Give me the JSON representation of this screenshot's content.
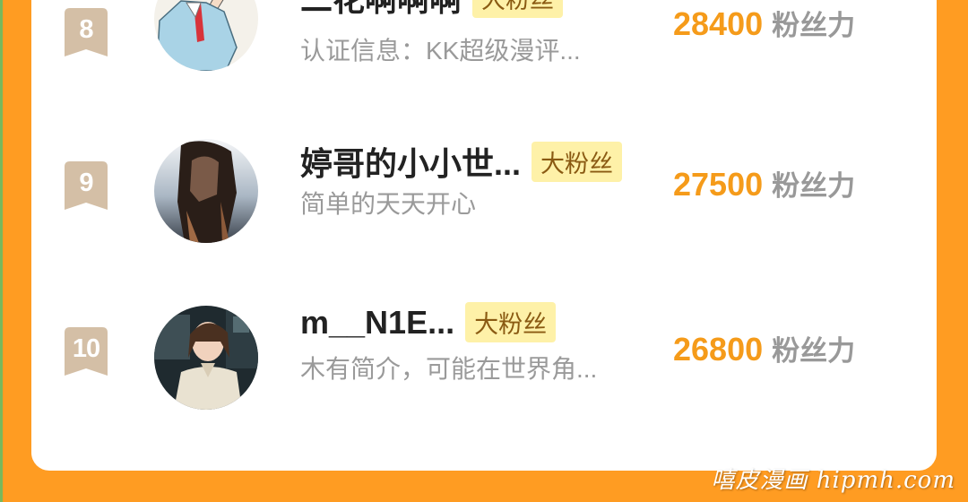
{
  "colors": {
    "background": "#ff9c22",
    "card": "#ffffff",
    "rank_badge": "#d4bfa6",
    "score": "#f59b1a",
    "badge_bg": "#fef1a8",
    "badge_text": "#8a5a12"
  },
  "ranking": [
    {
      "rank": "8",
      "name": "二花啊啊啊",
      "badge": "大粉丝",
      "description": "认证信息：KK超级漫评...",
      "score": "28400",
      "score_unit": "粉丝力",
      "avatar_icon": "cartoon-girl-avatar-icon"
    },
    {
      "rank": "9",
      "name": "婷哥的小小世...",
      "badge": "大粉丝",
      "description": "简单的天天开心",
      "score": "27500",
      "score_unit": "粉丝力",
      "avatar_icon": "long-hair-photo-avatar-icon"
    },
    {
      "rank": "10",
      "name": "m__N1E...",
      "badge": "大粉丝",
      "description": "木有简介，可能在世界角...",
      "score": "26800",
      "score_unit": "粉丝力",
      "avatar_icon": "woman-photo-avatar-icon"
    }
  ],
  "watermark": "嘻皮漫画 hipmh.com"
}
